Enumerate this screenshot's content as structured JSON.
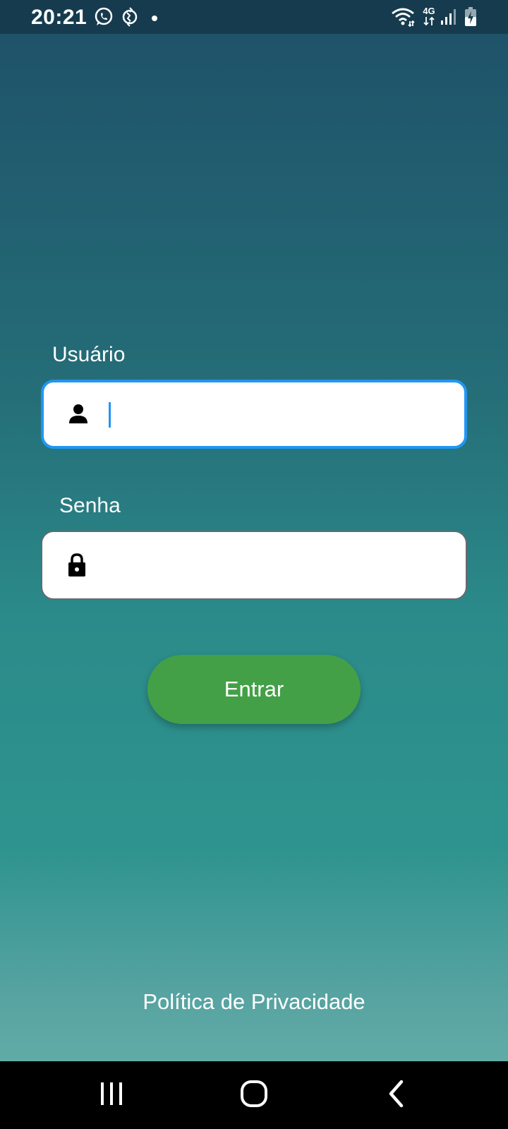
{
  "status_bar": {
    "time": "20:21",
    "left_icons": [
      "whatsapp-icon",
      "vpn-globe-icon",
      "notification-dot-icon"
    ],
    "right_icons": [
      "wifi-icon",
      "network-4g-icon",
      "signal-icon",
      "battery-charging-icon"
    ],
    "network_label": "4G"
  },
  "form": {
    "username_label": "Usuário",
    "username_value": "",
    "password_label": "Senha",
    "password_value": "",
    "login_button_label": "Entrar"
  },
  "footer": {
    "privacy_link": "Política de Privacidade"
  },
  "colors": {
    "background_top": "#1e5068",
    "background_bottom": "#6db3ad",
    "focus_border": "#2196f3",
    "button": "#43a047",
    "status_bar": "#163b4e"
  },
  "nav_bar": {
    "buttons": [
      "recent-apps-icon",
      "home-icon",
      "back-icon"
    ]
  }
}
